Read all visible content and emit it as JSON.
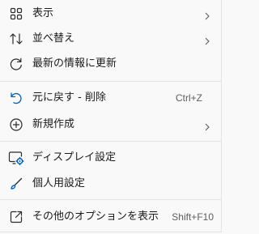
{
  "menu": {
    "items": [
      {
        "label": "表示",
        "icon": "grid-view-icon",
        "submenu": true
      },
      {
        "label": "並べ替え",
        "icon": "sort-icon",
        "submenu": true
      },
      {
        "label": "最新の情報に更新",
        "icon": "refresh-icon"
      },
      {
        "label": "元に戻す - 削除",
        "icon": "undo-icon",
        "shortcut": "Ctrl+Z"
      },
      {
        "label": "新規作成",
        "icon": "add-circle-icon",
        "submenu": true
      },
      {
        "label": "ディスプレイ設定",
        "icon": "display-settings-icon"
      },
      {
        "label": "個人用設定",
        "icon": "brush-icon"
      },
      {
        "label": "その他のオプションを表示",
        "icon": "open-external-icon",
        "shortcut": "Shift+F10"
      }
    ]
  },
  "colors": {
    "accent": "#005fb8",
    "text": "#1b1b1b",
    "background": "#f9f9f9",
    "separator": "#e3e3e3"
  }
}
